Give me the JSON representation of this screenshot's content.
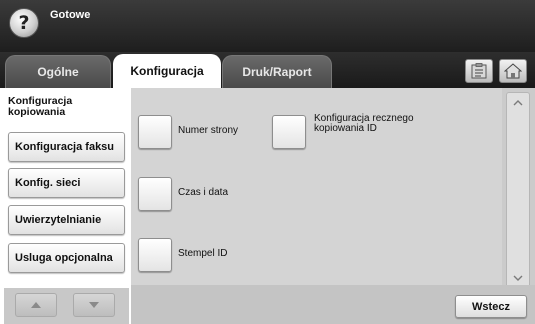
{
  "header": {
    "status": "Gotowe",
    "help_symbol": "?"
  },
  "tabs": [
    {
      "label": "Ogólne",
      "active": false
    },
    {
      "label": "Konfiguracja",
      "active": true
    },
    {
      "label": "Druk/Raport",
      "active": false
    }
  ],
  "toolbar": {
    "clipboard_icon": "clipboard-icon",
    "home_icon": "home-icon"
  },
  "sidebar": {
    "active": "Konfiguracja kopiowania",
    "items": [
      {
        "label": "Konfiguracja faksu"
      },
      {
        "label": "Konfig. sieci"
      },
      {
        "label": "Uwierzytelnianie"
      },
      {
        "label": "Usluga opcjonalna"
      }
    ]
  },
  "options": {
    "page_number": "Numer strony",
    "time_date": "Czas i data",
    "stamp_id": "Stempel ID",
    "manual_id_copy": "Konfiguracja recznego kopiowania ID"
  },
  "footer": {
    "back_label": "Wstecz"
  },
  "colors": {
    "topbar": "#2a2a2a",
    "panel": "#d4d4d4",
    "button": "#f0f0f0"
  }
}
